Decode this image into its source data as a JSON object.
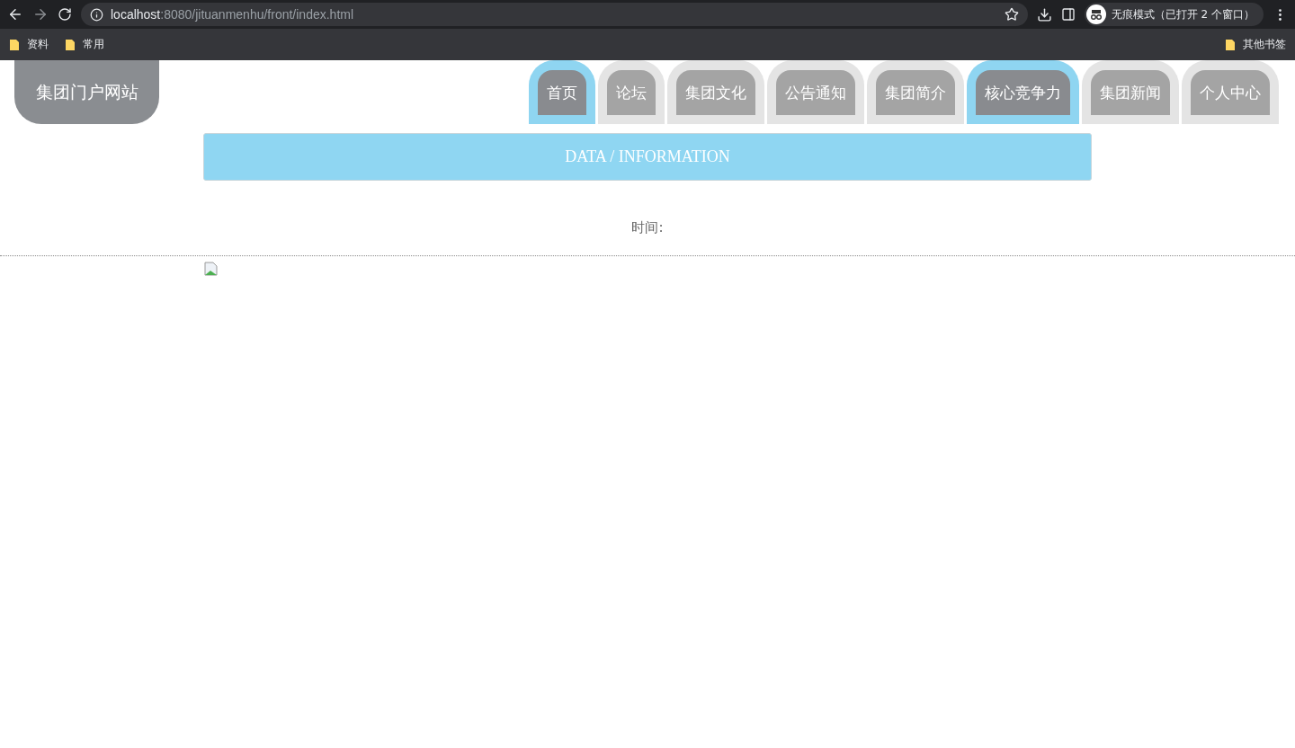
{
  "browser": {
    "url_host": "localhost",
    "url_path": ":8080/jituanmenhu/front/index.html",
    "profile_label": "无痕模式（已打开 2 个窗口）",
    "bookmarks": [
      "资料",
      "常用"
    ],
    "other_bookmarks": "其他书签"
  },
  "site": {
    "logo": "集团门户网站"
  },
  "nav": [
    {
      "label": "首页",
      "highlighted": true
    },
    {
      "label": "论坛",
      "highlighted": false
    },
    {
      "label": "集团文化",
      "highlighted": false
    },
    {
      "label": "公告通知",
      "highlighted": false
    },
    {
      "label": "集团简介",
      "highlighted": false
    },
    {
      "label": "核心竞争力",
      "highlighted": true
    },
    {
      "label": "集团新闻",
      "highlighted": false
    },
    {
      "label": "个人中心",
      "highlighted": false
    }
  ],
  "banner": {
    "title": "DATA / INFORMATION"
  },
  "article": {
    "time_label": "时间:"
  }
}
